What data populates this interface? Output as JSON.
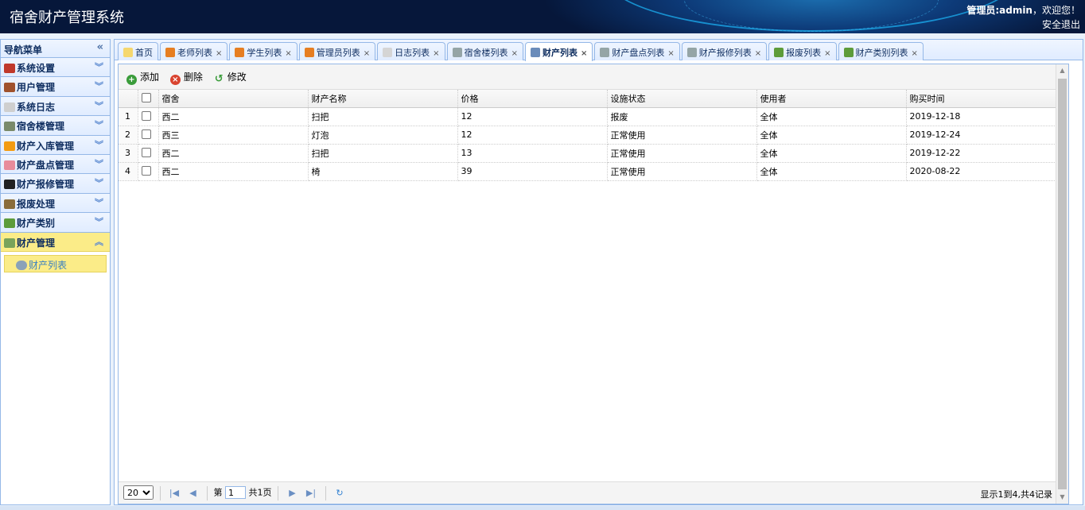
{
  "header": {
    "title": "宿舍财产管理系统",
    "user_prefix": "管理员:",
    "user_name": "admin",
    "welcome": "，欢迎您！",
    "logout": "安全退出"
  },
  "sidebar": {
    "title": "导航菜单",
    "collapse": "«",
    "items": [
      {
        "label": "系统设置",
        "icon": "tools-icon",
        "color": "#c0392b"
      },
      {
        "label": "用户管理",
        "icon": "user-icon",
        "color": "#a0522d"
      },
      {
        "label": "系统日志",
        "icon": "document-icon",
        "color": "#cfcfcf"
      },
      {
        "label": "宿舍楼管理",
        "icon": "building-icon",
        "color": "#7a8a6a"
      },
      {
        "label": "财产入库管理",
        "icon": "star-icon",
        "color": "#f39c12"
      },
      {
        "label": "财产盘点管理",
        "icon": "flower-icon",
        "color": "#e88b9b"
      },
      {
        "label": "财产报修管理",
        "icon": "terminal-icon",
        "color": "#222222"
      },
      {
        "label": "报废处理",
        "icon": "box-icon",
        "color": "#8a6d3b"
      },
      {
        "label": "财产类别",
        "icon": "leaf-icon",
        "color": "#5d9c3a"
      },
      {
        "label": "财产管理",
        "icon": "money-icon",
        "color": "#79a35a"
      }
    ],
    "submenu": {
      "label": "财产列表",
      "icon": "money-icon"
    }
  },
  "tabs": [
    {
      "label": "首页",
      "closable": false,
      "icon": "bulb-icon",
      "color": "#f5d76e"
    },
    {
      "label": "老师列表",
      "closable": true,
      "icon": "user-icon",
      "color": "#e67e22"
    },
    {
      "label": "学生列表",
      "closable": true,
      "icon": "user-icon",
      "color": "#e67e22"
    },
    {
      "label": "管理员列表",
      "closable": true,
      "icon": "user-icon",
      "color": "#e67e22"
    },
    {
      "label": "日志列表",
      "closable": true,
      "icon": "document-icon",
      "color": "#d5d5d5"
    },
    {
      "label": "宿舍楼列表",
      "closable": true,
      "icon": "tools-icon",
      "color": "#95a5a6"
    },
    {
      "label": "财产列表",
      "closable": true,
      "icon": "save-icon",
      "color": "#6b8cba"
    },
    {
      "label": "财产盘点列表",
      "closable": true,
      "icon": "tools-icon",
      "color": "#95a5a6"
    },
    {
      "label": "财产报修列表",
      "closable": true,
      "icon": "tools-icon",
      "color": "#95a5a6"
    },
    {
      "label": "报废列表",
      "closable": true,
      "icon": "leaf-icon",
      "color": "#5d9c3a"
    },
    {
      "label": "财产类别列表",
      "closable": true,
      "icon": "leaf-icon",
      "color": "#5d9c3a"
    }
  ],
  "selected_tab": "财产列表",
  "toolbar": {
    "add": "添加",
    "delete": "删除",
    "edit": "修改"
  },
  "table": {
    "columns": [
      "宿舍",
      "财产名称",
      "价格",
      "设施状态",
      "使用者",
      "购买时间"
    ],
    "rows": [
      {
        "n": "1",
        "cells": [
          "西二",
          "扫把",
          "12",
          "报废",
          "全体",
          "2019-12-18"
        ]
      },
      {
        "n": "2",
        "cells": [
          "西三",
          "灯泡",
          "12",
          "正常使用",
          "全体",
          "2019-12-24"
        ]
      },
      {
        "n": "3",
        "cells": [
          "西二",
          "扫把",
          "13",
          "正常使用",
          "全体",
          "2019-12-22"
        ]
      },
      {
        "n": "4",
        "cells": [
          "西二",
          "椅",
          "39",
          "正常使用",
          "全体",
          "2020-08-22"
        ]
      }
    ]
  },
  "pager": {
    "page_size": "20",
    "page_prefix": "第",
    "page_value": "1",
    "page_total": "共1页",
    "info": "显示1到4,共4记录"
  }
}
